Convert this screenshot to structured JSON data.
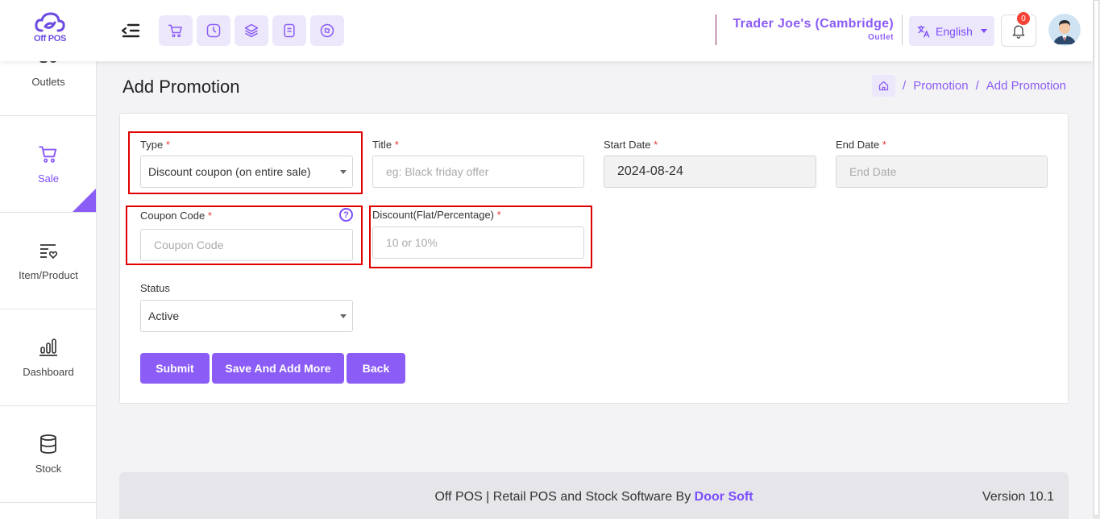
{
  "app": {
    "logo_text": "Off POS"
  },
  "topbar": {
    "store_name": "Trader Joe's (Cambridge)",
    "store_sub": "Outlet",
    "language": "English",
    "notification_count": "0"
  },
  "sidebar": {
    "items": [
      {
        "label": "Outlets",
        "icon": "outlets-icon"
      },
      {
        "label": "Sale",
        "icon": "cart-icon"
      },
      {
        "label": "Item/Product",
        "icon": "list-heart-icon"
      },
      {
        "label": "Dashboard",
        "icon": "bar-chart-icon"
      },
      {
        "label": "Stock",
        "icon": "database-icon"
      }
    ]
  },
  "page": {
    "title": "Add Promotion",
    "breadcrumb": [
      "Promotion",
      "Add Promotion"
    ]
  },
  "form": {
    "type_label": "Type",
    "type_value": "Discount coupon (on entire sale)",
    "title_label": "Title",
    "title_placeholder": "eg: Black friday offer",
    "start_date_label": "Start Date",
    "start_date_value": "2024-08-24",
    "end_date_label": "End Date",
    "end_date_placeholder": "End Date",
    "coupon_label": "Coupon Code",
    "coupon_placeholder": "Coupon Code",
    "discount_label": "Discount(Flat/Percentage)",
    "discount_placeholder": "10 or 10%",
    "status_label": "Status",
    "status_value": "Active",
    "required_mark": "*",
    "help_mark": "?"
  },
  "buttons": {
    "submit": "Submit",
    "save_add_more": "Save And Add More",
    "back": "Back"
  },
  "footer": {
    "text": "Off POS | Retail POS and Stock Software By ",
    "brand": "Door Soft",
    "version": "Version 10.1"
  },
  "colors": {
    "accent": "#8b5cf6",
    "highlight": "#e00000",
    "badge": "#f44336"
  }
}
